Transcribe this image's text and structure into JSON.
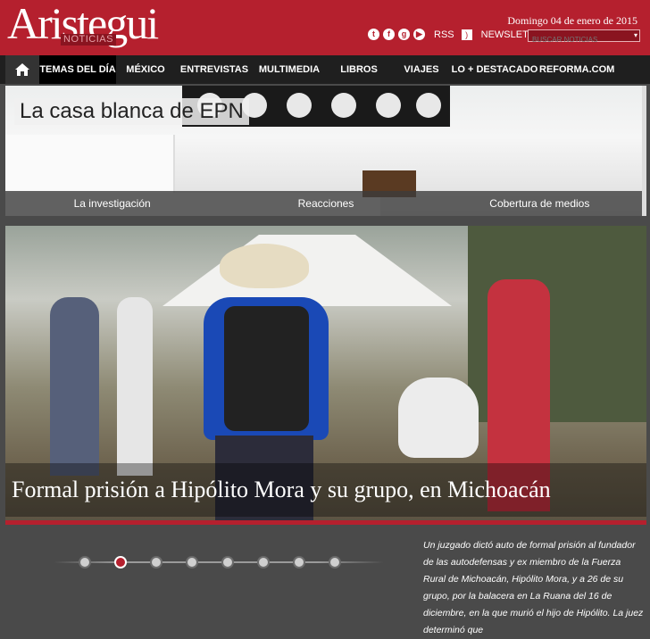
{
  "brand": {
    "name": "Aristegui",
    "sub": "NOTICIAS",
    "colors": {
      "primary": "#b5202e",
      "dark": "#1f1f1f"
    }
  },
  "header": {
    "date": "Domingo 04 de enero de 2015",
    "rss_label": "RSS",
    "newsletter_label": "NEWSLETTER",
    "search_placeholder": "BUSCAR NOTICIAS",
    "social_icons": [
      "twitter-icon",
      "facebook-icon",
      "google-plus-icon",
      "youtube-icon"
    ]
  },
  "nav": {
    "items": [
      {
        "label": "TEMAS DEL DÍA",
        "active": true
      },
      {
        "label": "MÉXICO"
      },
      {
        "label": "ENTREVISTAS"
      },
      {
        "label": "MULTIMEDIA"
      },
      {
        "label": "LIBROS"
      },
      {
        "label": "VIAJES"
      },
      {
        "label": "LO + DESTACADO"
      },
      {
        "label": "REFORMA.COM"
      }
    ]
  },
  "feature": {
    "title": "La casa blanca de EPN",
    "tabs": [
      "La investigación",
      "Reacciones",
      "Cobertura de medios"
    ]
  },
  "hero": {
    "headline": "Formal prisión a Hipólito Mora y su grupo, en Michoacán",
    "summary": "Un juzgado dictó auto de formal prisión al fundador de las autodefensas y ex miembro de la Fuerza Rural de Michoacán, Hipólito Mora, y a 26 de su grupo, por la balacera en La Ruana del 16 de diciembre, en la que murió el hijo de Hipólito. La juez determinó que",
    "slides_total": 8,
    "slide_active": 2
  }
}
